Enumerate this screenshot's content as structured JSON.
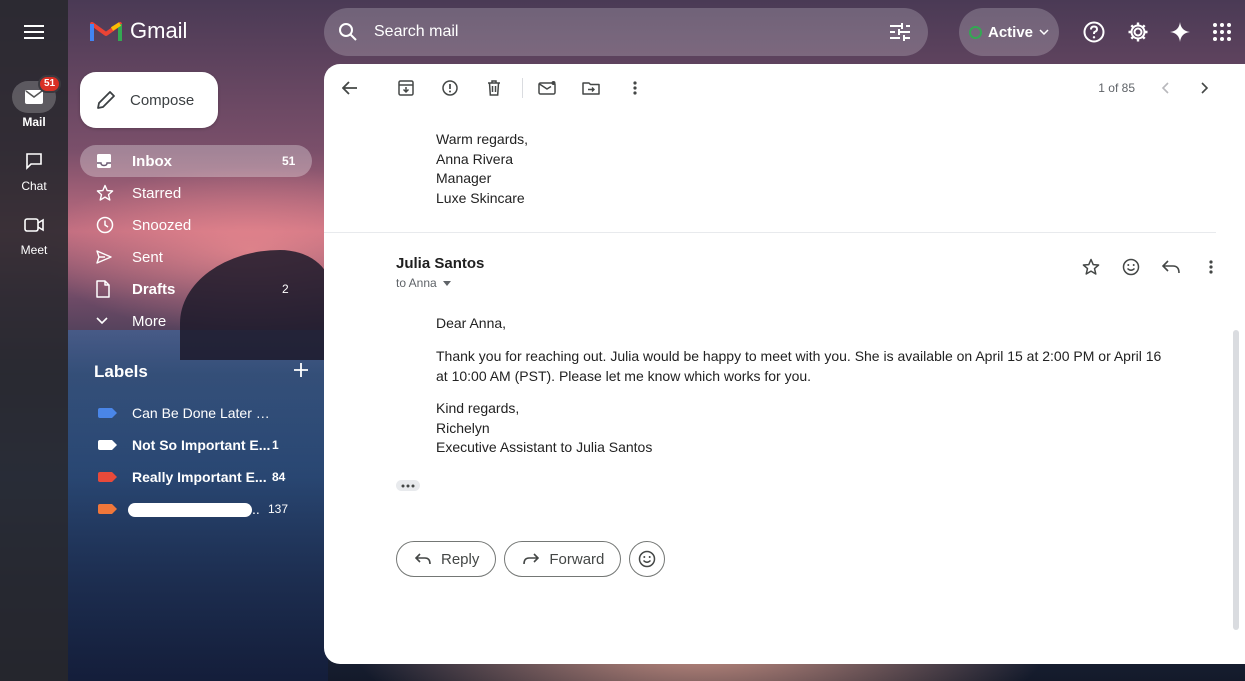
{
  "rail": {
    "mail": {
      "label": "Mail",
      "badge": "51"
    },
    "chat": {
      "label": "Chat"
    },
    "meet": {
      "label": "Meet"
    }
  },
  "app": {
    "name": "Gmail"
  },
  "search": {
    "placeholder": "Search mail"
  },
  "status": {
    "label": "Active",
    "color": "#34a853"
  },
  "compose": {
    "label": "Compose"
  },
  "nav": {
    "items": [
      {
        "label": "Inbox",
        "count": "51"
      },
      {
        "label": "Starred",
        "count": ""
      },
      {
        "label": "Snoozed",
        "count": ""
      },
      {
        "label": "Sent",
        "count": ""
      },
      {
        "label": "Drafts",
        "count": "2"
      },
      {
        "label": "More",
        "count": ""
      }
    ]
  },
  "labels": {
    "title": "Labels",
    "items": [
      {
        "label": "Can Be Done Later Email",
        "count": "",
        "color": "#4a86e8"
      },
      {
        "label": "Not So Important E...",
        "count": "1",
        "color": "#ffffff"
      },
      {
        "label": "Really Important E...",
        "count": "84",
        "color": "#e84a3a"
      },
      {
        "label": "..",
        "count": "137",
        "color": "#f0773a"
      }
    ]
  },
  "pager": {
    "text": "1 of 85"
  },
  "previous_message": {
    "signature": [
      "Warm regards,",
      "Anna Rivera",
      "Manager",
      "Luxe Skincare"
    ]
  },
  "message": {
    "sender": "Julia Santos",
    "to": "to Anna",
    "greeting": "Dear Anna,",
    "body": "Thank you for reaching out. Julia would be happy to meet with you. She is available on April 15 at 2:00 PM or April 16 at 10:00 AM (PST). Please let me know which works for you.",
    "closing": [
      "Kind regards,",
      "Richelyn",
      "Executive Assistant to Julia Santos"
    ]
  },
  "actions": {
    "reply": "Reply",
    "forward": "Forward"
  }
}
